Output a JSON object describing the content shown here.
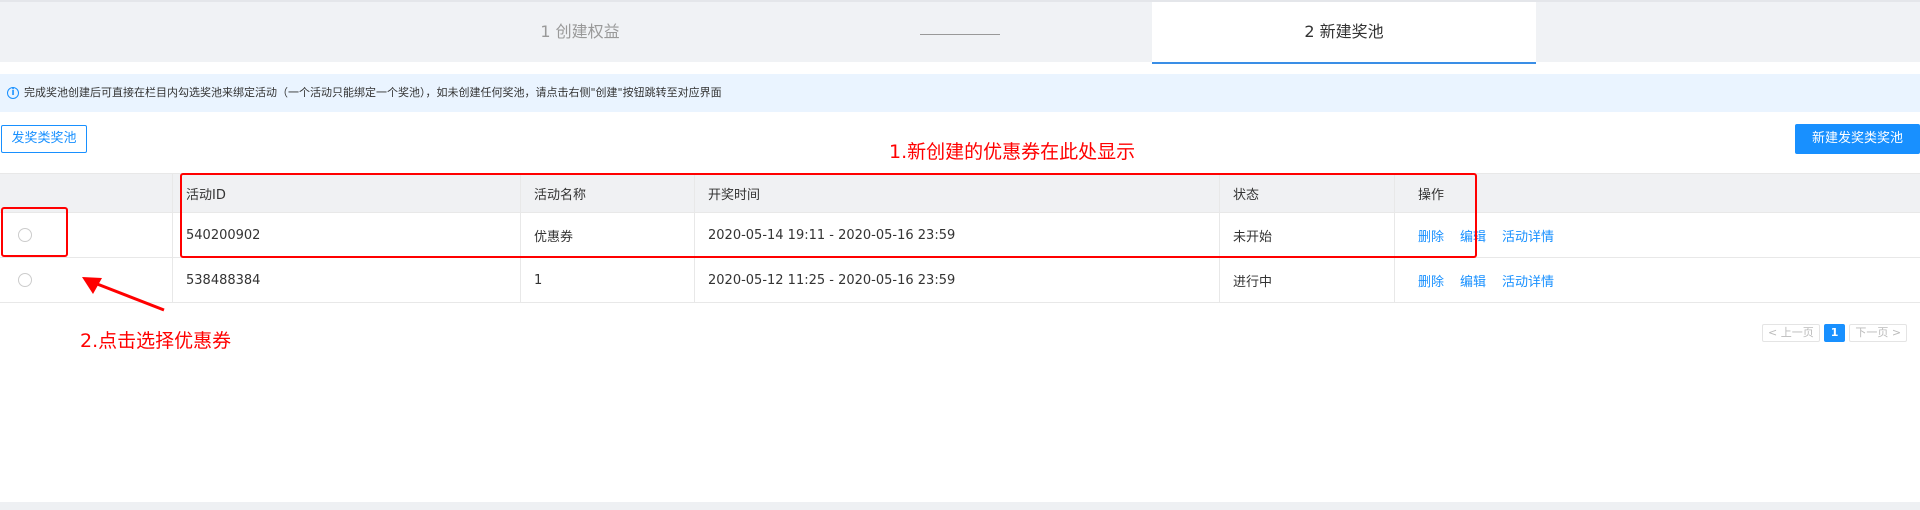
{
  "steps": {
    "step1": "1 创建权益",
    "step2": "2 新建奖池"
  },
  "info": {
    "text": "完成奖池创建后可直接在栏目内勾选奖池来绑定活动（一个活动只能绑定一个奖池），如未创建任何奖池，请点击右侧\"创建\"按钮跳转至对应界面",
    "icon": "info-icon",
    "icon_glyph": "i"
  },
  "toolbar": {
    "pool_tab": "发奖类奖池",
    "new_button": "新建发奖类奖池"
  },
  "table": {
    "headers": [
      "活动ID",
      "活动名称",
      "开奖时间",
      "状态",
      "操作"
    ],
    "rows": [
      {
        "id": "540200902",
        "name": "优惠券",
        "time": "2020-05-14 19:11 - 2020-05-16 23:59",
        "status": "未开始",
        "actions": [
          "删除",
          "编辑",
          "活动详情"
        ]
      },
      {
        "id": "538488384",
        "name": "1",
        "time": "2020-05-12 11:25 - 2020-05-16 23:59",
        "status": "进行中",
        "actions": [
          "删除",
          "编辑",
          "活动详情"
        ]
      }
    ]
  },
  "pagination": {
    "prev": "< 上一页",
    "current": "1",
    "next": "下一页 >"
  },
  "annotations": {
    "note1": "1.新创建的优惠券在此处显示",
    "note2": "2.点击选择优惠券"
  },
  "colors": {
    "accent": "#1890ff",
    "annotation": "#ff0000"
  }
}
